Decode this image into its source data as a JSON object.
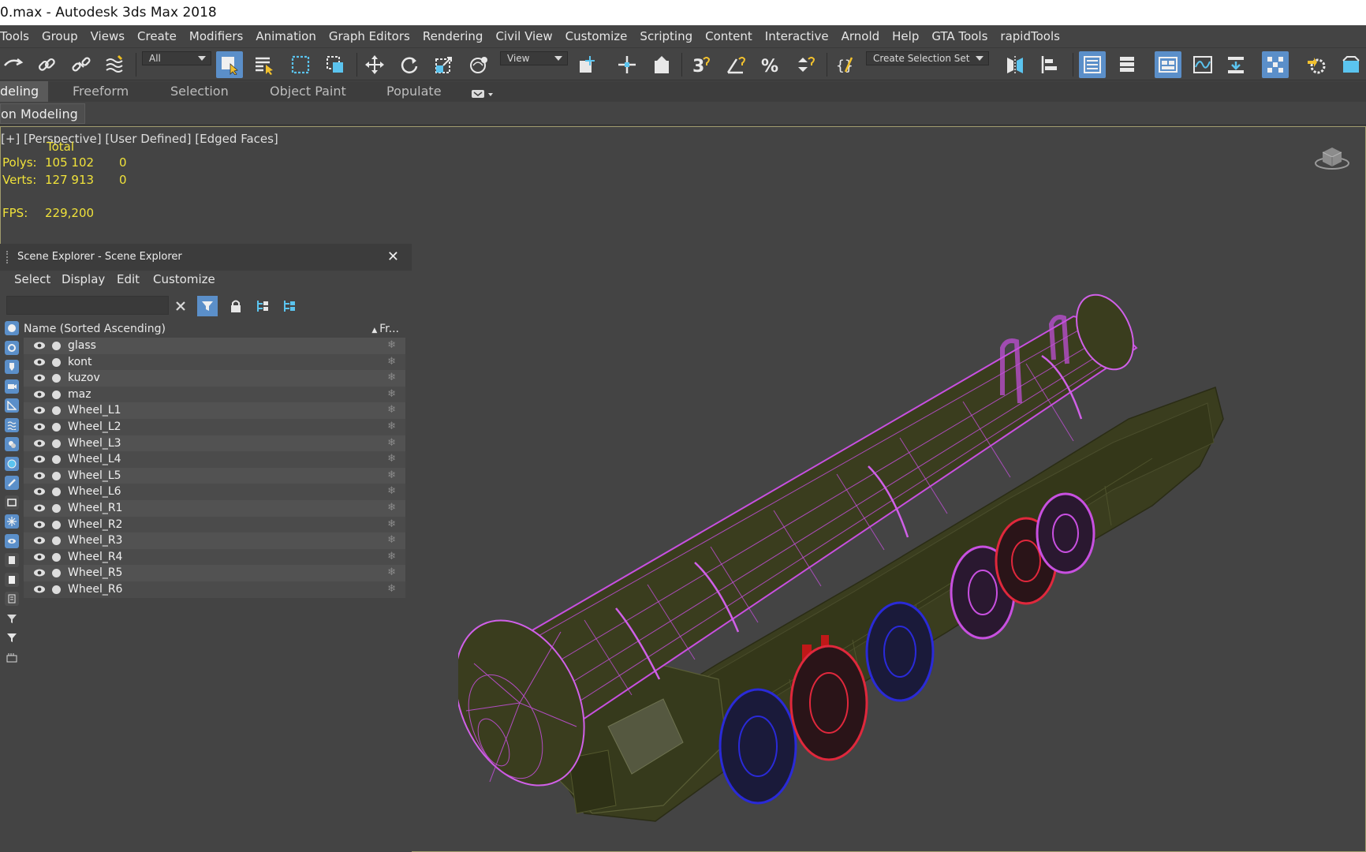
{
  "window": {
    "title": "0.max - Autodesk 3ds Max 2018"
  },
  "menubar": {
    "items": [
      "Tools",
      "Group",
      "Views",
      "Create",
      "Modifiers",
      "Animation",
      "Graph Editors",
      "Rendering",
      "Civil View",
      "Customize",
      "Scripting",
      "Content",
      "Interactive",
      "Arnold",
      "Help",
      "GTA Tools",
      "rapidTools"
    ]
  },
  "toolbar": {
    "selection_filter": "All",
    "ref_coord": "View",
    "selection_set": "Create Selection Set"
  },
  "ribbon": {
    "tabs": [
      "deling",
      "Freeform",
      "Selection",
      "Object Paint",
      "Populate"
    ],
    "sub_panel": "on Modeling"
  },
  "viewport": {
    "label": "[+] [Perspective] [User Defined] [Edged Faces]",
    "stats": {
      "total_label": "Total",
      "polys_label": "Polys:",
      "polys_total": "105 102",
      "polys_sel": "0",
      "verts_label": "Verts:",
      "verts_total": "127 913",
      "verts_sel": "0",
      "fps_label": "FPS:",
      "fps_value": "229,200"
    }
  },
  "scene_explorer": {
    "title": "Scene Explorer - Scene Explorer",
    "menu": [
      "Select",
      "Display",
      "Edit",
      "Customize"
    ],
    "column_name": "Name (Sorted Ascending)",
    "column_frozen": "Fr...",
    "objects": [
      "glass",
      "kont",
      "kuzov",
      "maz",
      "Wheel_L1",
      "Wheel_L2",
      "Wheel_L3",
      "Wheel_L4",
      "Wheel_L5",
      "Wheel_L6",
      "Wheel_R1",
      "Wheel_R2",
      "Wheel_R3",
      "Wheel_R4",
      "Wheel_R5",
      "Wheel_R6"
    ]
  },
  "colors": {
    "accent": "#5b8fc9",
    "stats_text": "#f0e23a",
    "wire_magenta": "#c850e0",
    "wire_red": "#e0283c",
    "wire_blue": "#2a2ad8",
    "model_body": "#3a3d1e"
  }
}
